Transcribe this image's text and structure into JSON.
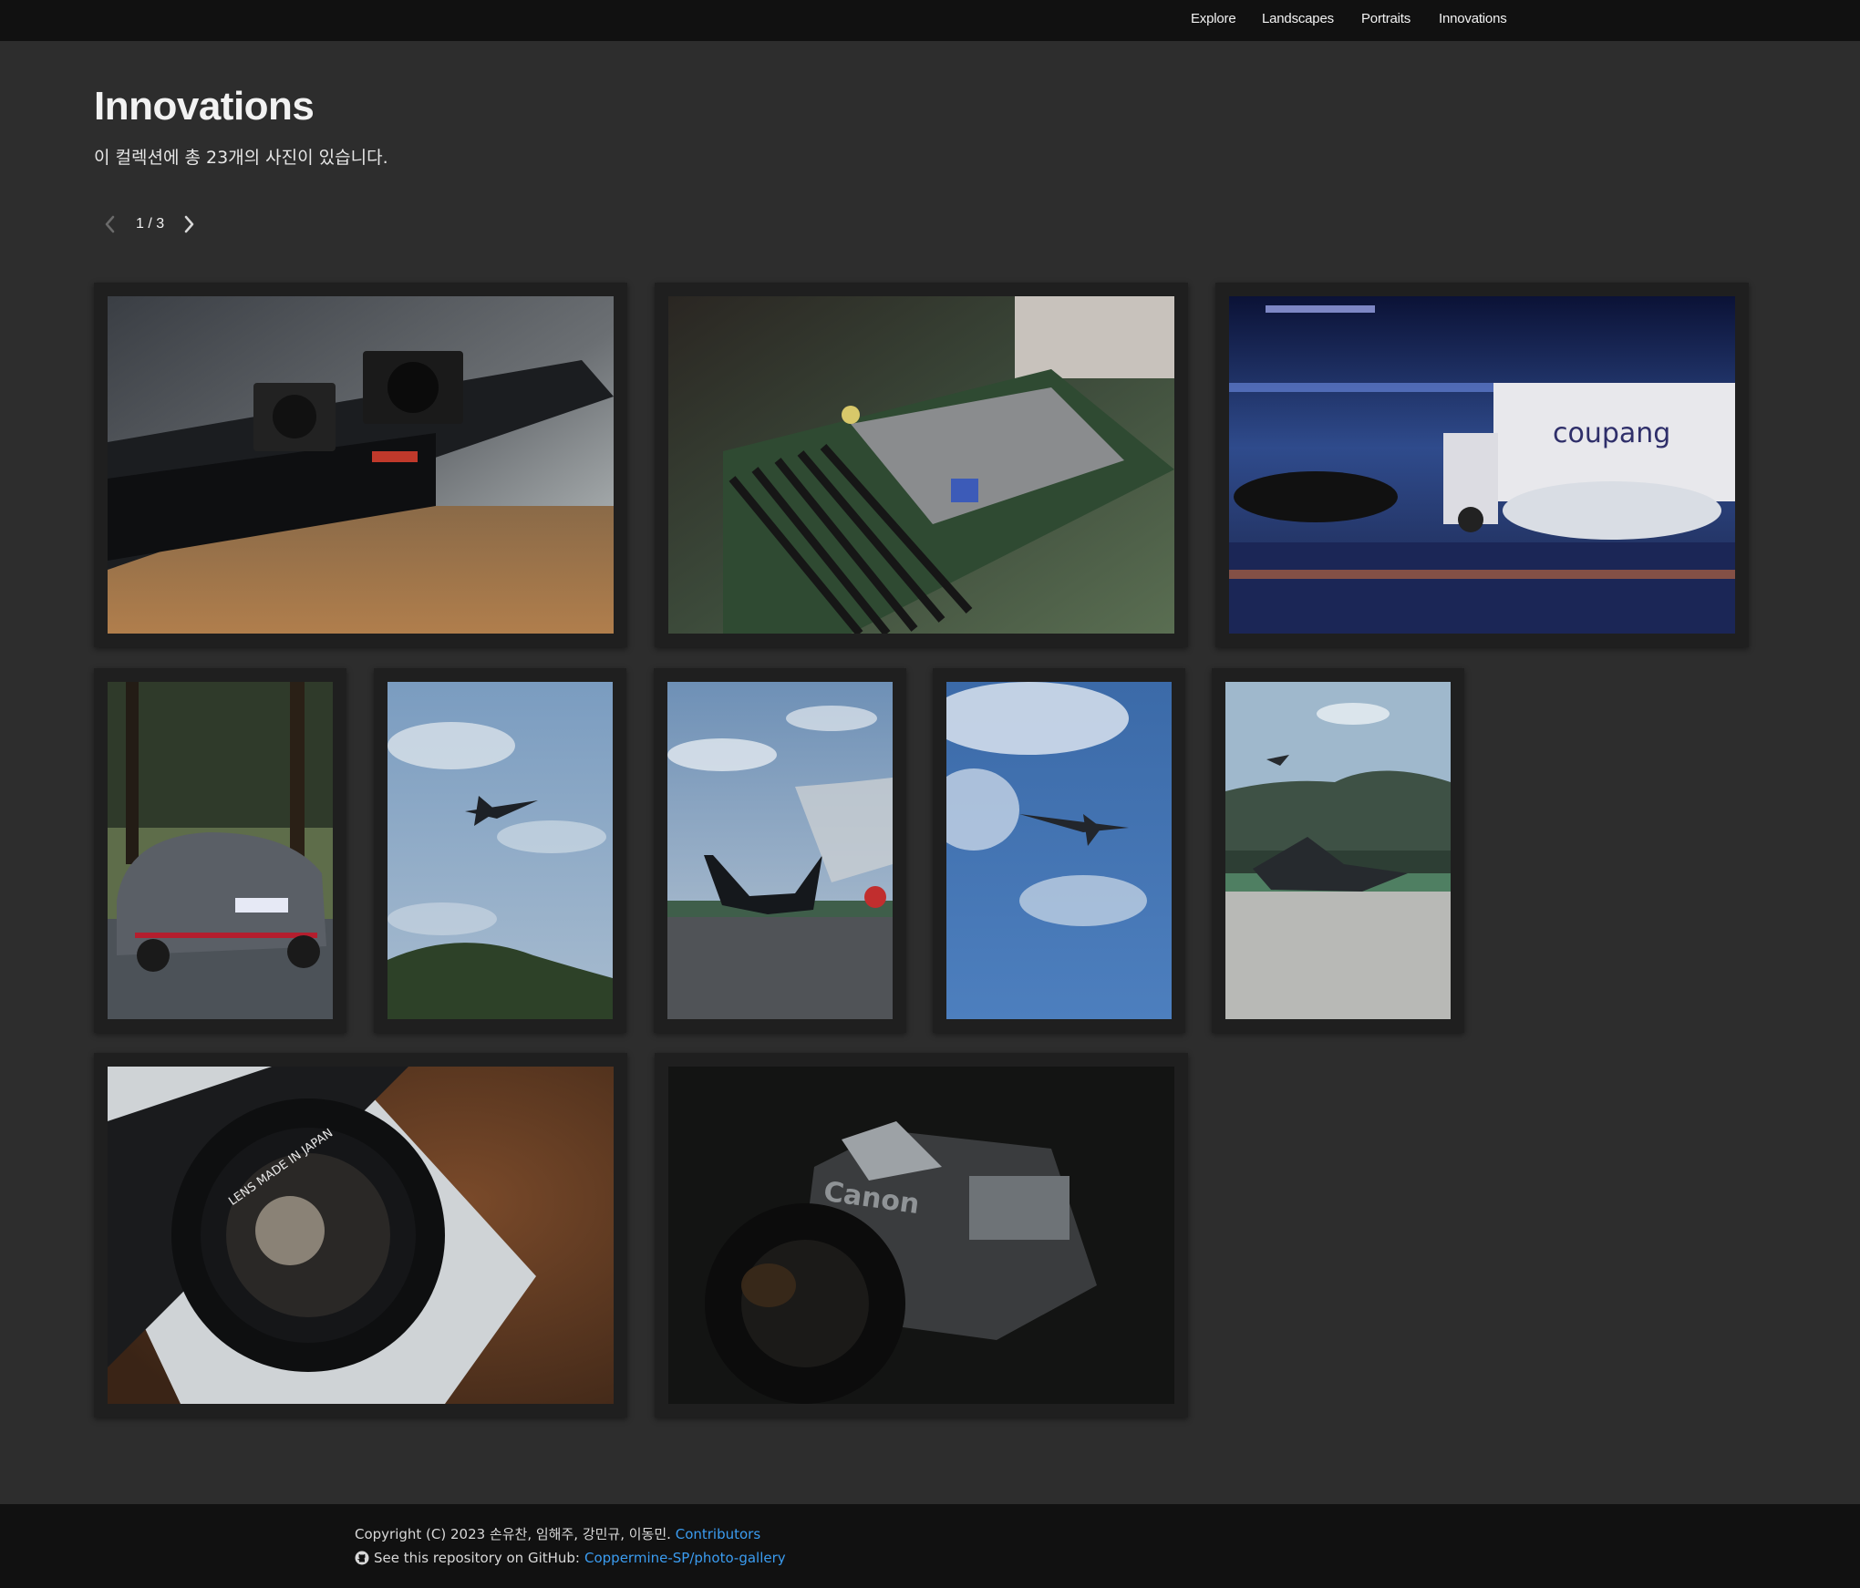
{
  "nav": {
    "items": [
      {
        "label": "Explore"
      },
      {
        "label": "Landscapes"
      },
      {
        "label": "Portraits"
      },
      {
        "label": "Innovations"
      }
    ]
  },
  "collection": {
    "title": "Innovations",
    "subtitle": "이 컬렉션에 총 23개의 사진이 있습니다."
  },
  "pagination": {
    "current": 1,
    "total": 3,
    "label": "1 / 3",
    "prev_icon": "chevron-left-icon",
    "next_icon": "chevron-right-icon"
  },
  "photos": [
    {
      "subject": "server-hardware"
    },
    {
      "subject": "circuit-board"
    },
    {
      "subject": "night-street-coupang-truck",
      "visible_text": "coupang"
    },
    {
      "subject": "hyundai-car"
    },
    {
      "subject": "fighter-jet-over-hills"
    },
    {
      "subject": "fighter-jets-on-runway"
    },
    {
      "subject": "jet-in-blue-sky"
    },
    {
      "subject": "jet-and-helicopter-airfield"
    },
    {
      "subject": "canon-lens-closeup",
      "visible_text": "LENS MADE IN JAPAN"
    },
    {
      "subject": "canon-camera-dark",
      "visible_text": "Canon"
    }
  ],
  "footer": {
    "copyright": "Copyright (C) 2023 손유찬, 임해주, 강민규, 이동민.",
    "contributors_label": "Contributors",
    "repo_text": "See this repository on GitHub:",
    "repo_link": "Coppermine-SP/photo-gallery",
    "github_icon": "github-icon"
  },
  "colors": {
    "page_bg": "#2d2d2d",
    "nav_bg": "#111111",
    "frame_bg": "#1f1f1f",
    "link": "#3b9cf0"
  }
}
